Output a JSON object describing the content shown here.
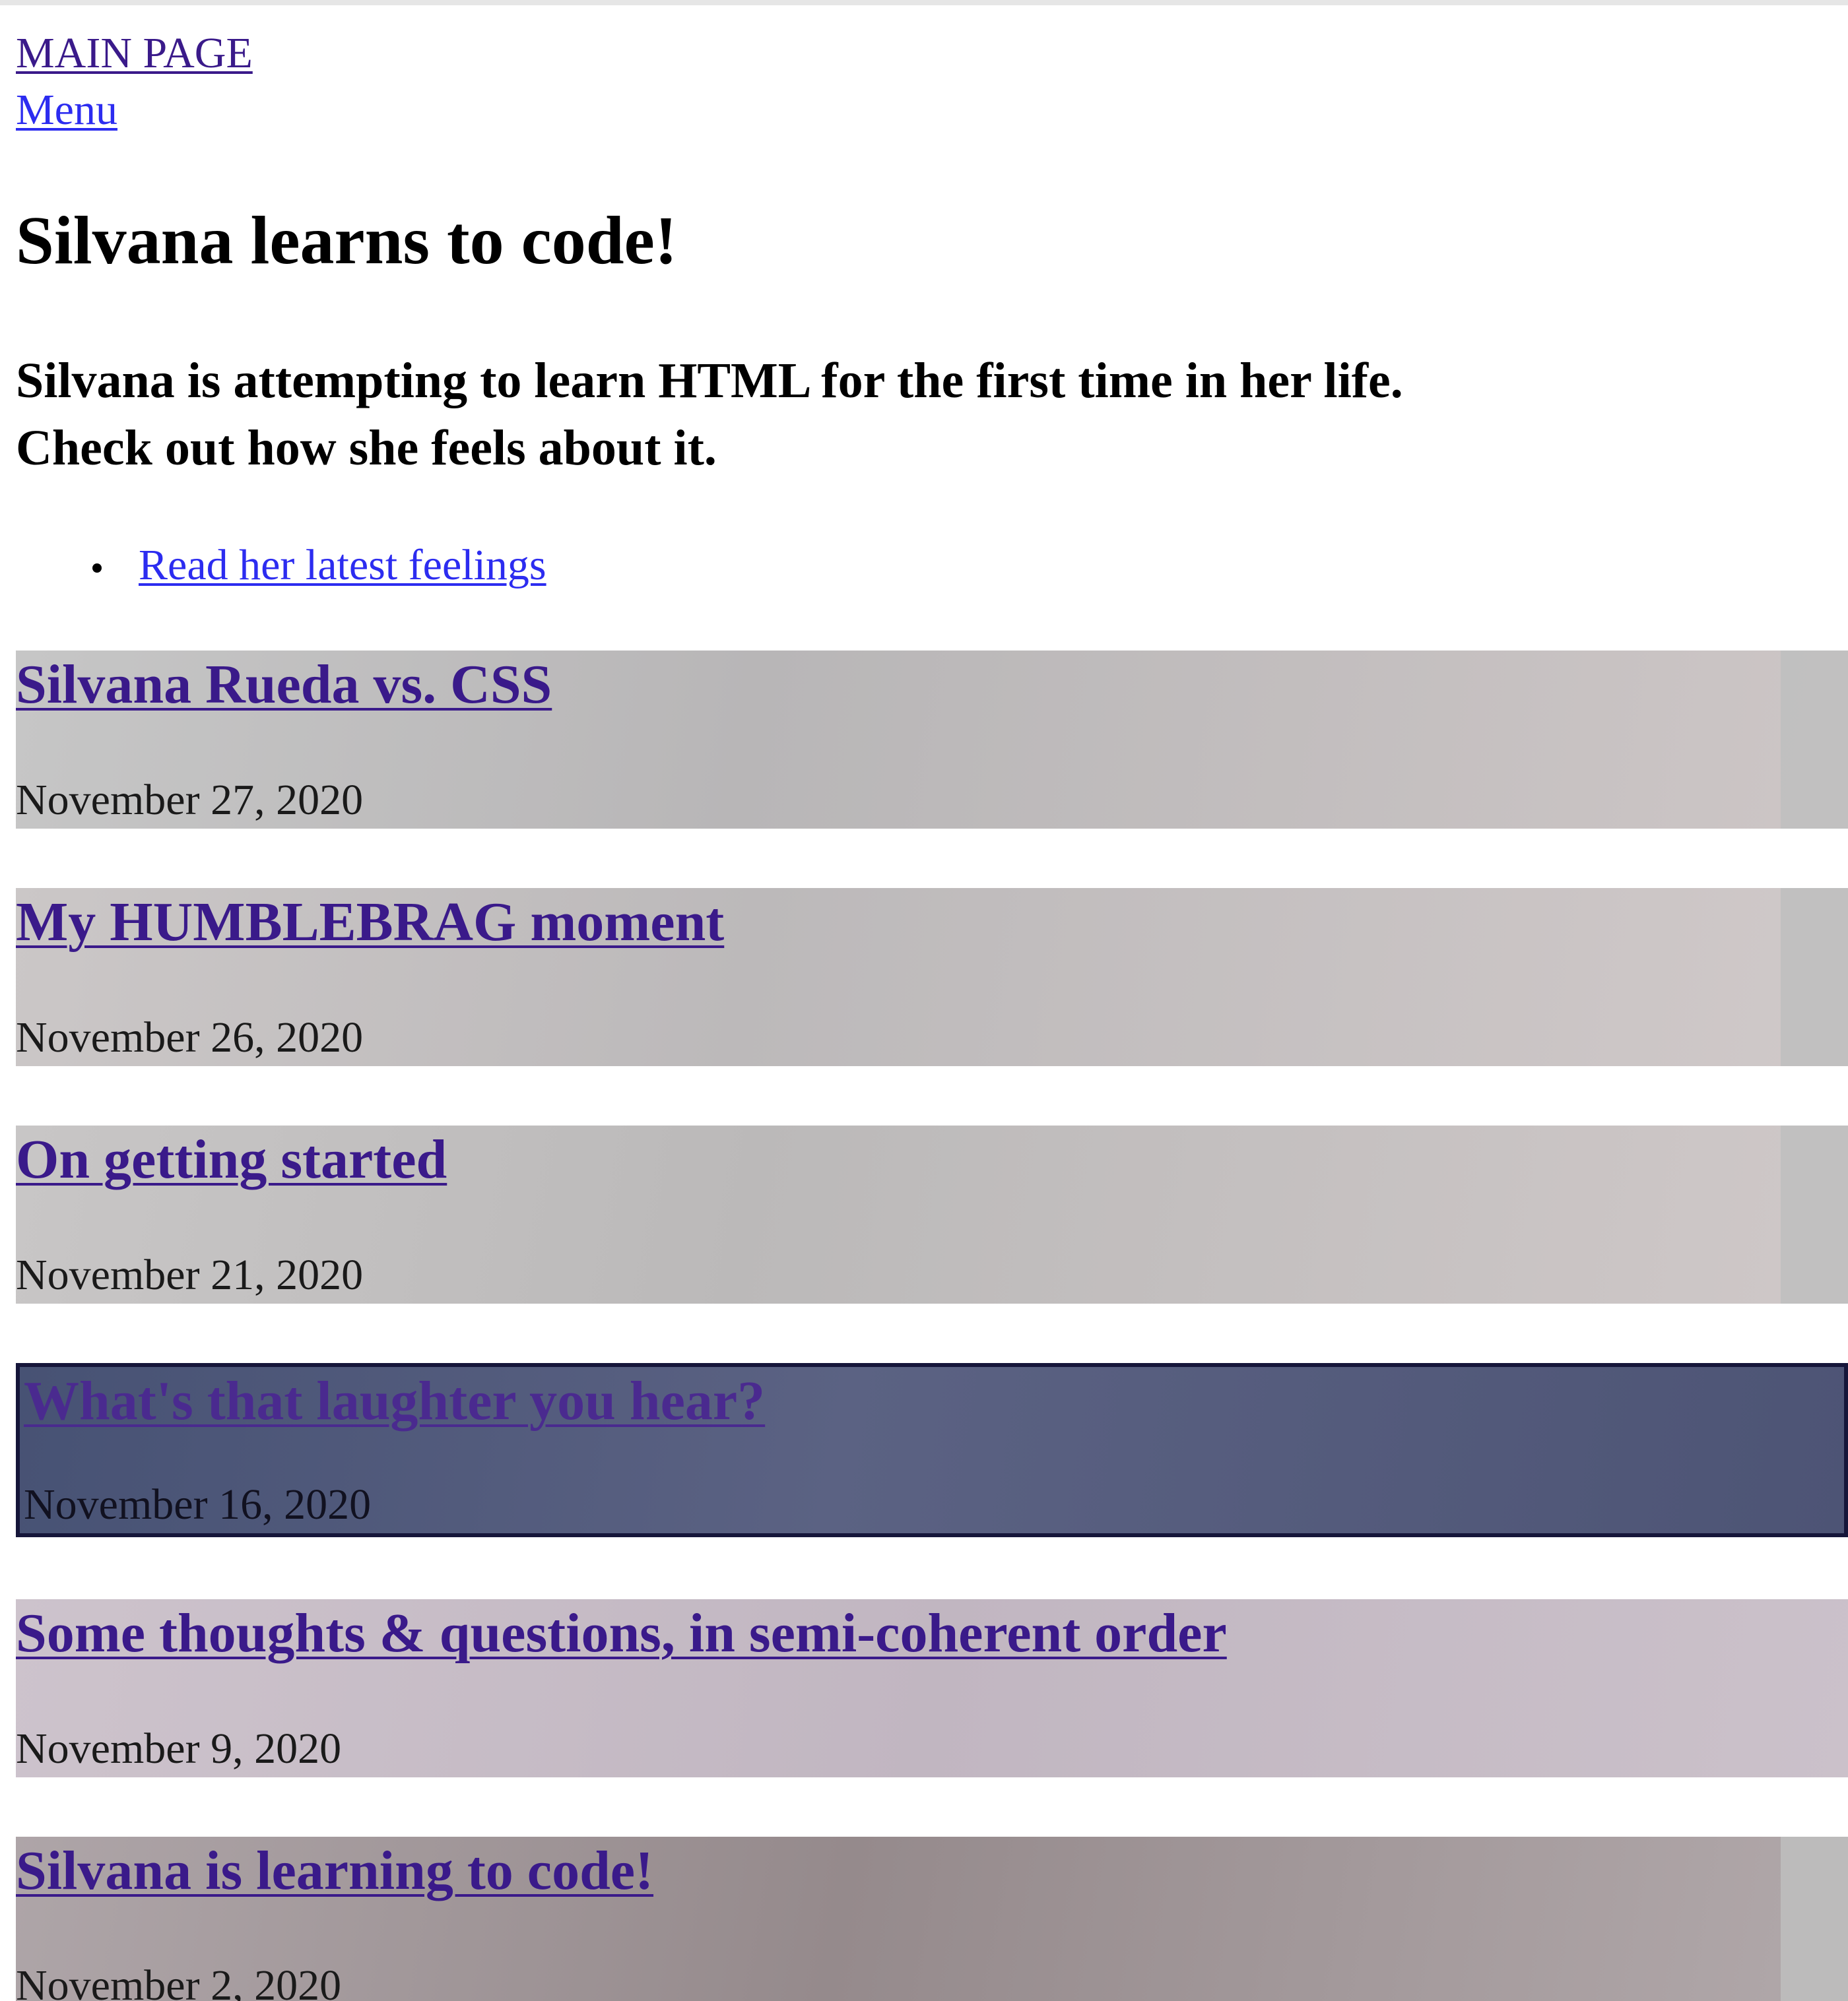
{
  "nav": {
    "main_page": "MAIN PAGE",
    "menu": "Menu"
  },
  "header": {
    "title": "Silvana learns to code!",
    "intro_line1": "Silvana is attempting to learn HTML for the first time in her life.",
    "intro_line2": "Check out how she feels about it."
  },
  "links": {
    "latest_feelings": "Read her latest feelings"
  },
  "posts": [
    {
      "title": "Silvana Rueda vs. CSS",
      "date": "November 27, 2020"
    },
    {
      "title": "My HUMBLEBRAG moment",
      "date": "November 26, 2020"
    },
    {
      "title": "On getting started",
      "date": "November 21, 2020"
    },
    {
      "title": "What's that laughter you hear?",
      "date": "November 16, 2020"
    },
    {
      "title": "Some thoughts & questions, in semi-coherent order",
      "date": "November 9, 2020"
    },
    {
      "title": "Silvana is learning to code!",
      "date": "November 2, 2020"
    }
  ],
  "colors": {
    "link_visited": "#3a1a8a",
    "link": "#2c2cf0",
    "highlight_post": "#475274"
  }
}
